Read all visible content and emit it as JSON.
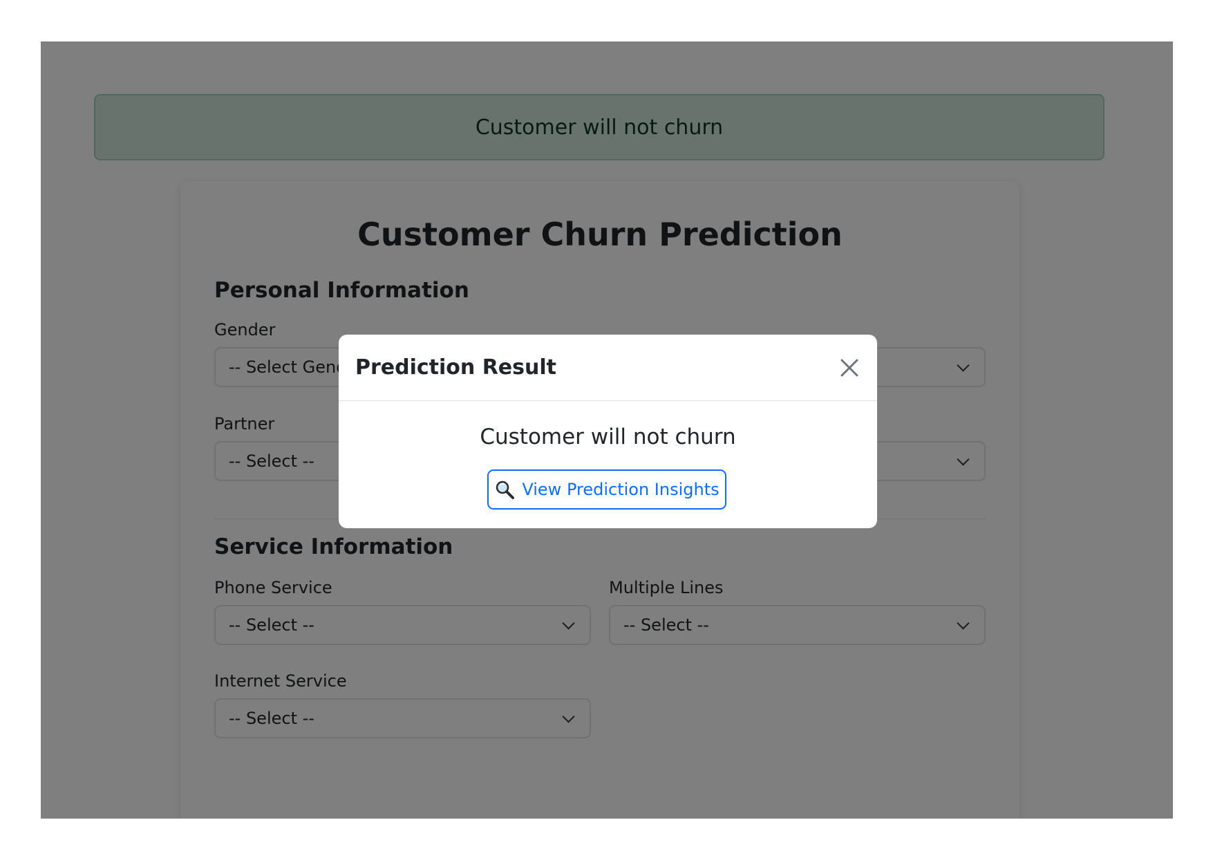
{
  "alert": {
    "text": "Customer will not churn"
  },
  "form": {
    "title": "Customer Churn Prediction",
    "personal_section": "Personal Information",
    "service_section": "Service Information",
    "fields": {
      "gender": {
        "label": "Gender",
        "value": "-- Select Gender --"
      },
      "partner": {
        "label": "Partner",
        "value": "-- Select --"
      },
      "phone_service": {
        "label": "Phone Service",
        "value": "-- Select --"
      },
      "multiple_lines": {
        "label": "Multiple Lines",
        "value": "-- Select --"
      },
      "internet_service": {
        "label": "Internet Service",
        "value": "-- Select --"
      }
    }
  },
  "modal": {
    "title": "Prediction Result",
    "result": "Customer will not churn",
    "insights_button": "View Prediction Insights",
    "insights_icon": "magnifier-icon",
    "close_icon": "close-icon"
  },
  "colors": {
    "alert_bg": "#d1e7dd",
    "alert_text": "#0a3622",
    "primary": "#0d6efd",
    "backdrop": "rgba(0,0,0,0.5)"
  }
}
